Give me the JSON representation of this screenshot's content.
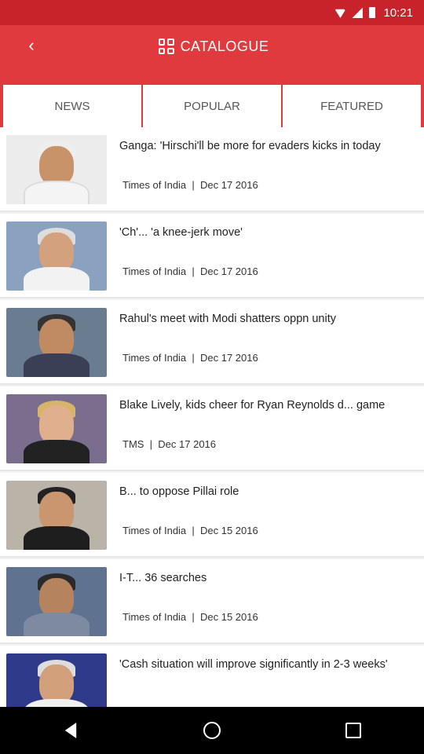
{
  "status_bar": {
    "time": "10:21"
  },
  "app_bar": {
    "back_icon": "chevron-left-icon",
    "catalogue_label": "CATALOGUE",
    "catalogue_icon": "grid-icon"
  },
  "tabs": [
    {
      "label": "NEWS"
    },
    {
      "label": "POPULAR"
    },
    {
      "label": "FEATURED"
    }
  ],
  "news": [
    {
      "headline": "Ganga: 'Hirschi'll be more for evaders kicks in today",
      "source": "Times of India",
      "date": "Dec 17 2016"
    },
    {
      "headline": "'Ch'... 'a knee-jerk move'",
      "source": "Times of India",
      "date": "Dec 17 2016"
    },
    {
      "headline": "Rahul's meet with Modi shatters oppn unity",
      "source": "Times of India",
      "date": "Dec 17 2016"
    },
    {
      "headline": "Blake Lively, kids cheer for Ryan Reynolds d... game",
      "source": "TMS",
      "date": "Dec 17 2016"
    },
    {
      "headline": "B... to oppose Pillai role",
      "source": "Times of India",
      "date": "Dec 15 2016"
    },
    {
      "headline": "I-T... 36 searches",
      "source": "Times of India",
      "date": "Dec 15 2016"
    },
    {
      "headline": "'Cash situation will improve significantly in 2-3 weeks'",
      "source": "",
      "date": ""
    }
  ],
  "nav_bar": {
    "back_icon": "triangle-back-icon",
    "home_icon": "circle-home-icon",
    "recents_icon": "square-recents-icon"
  },
  "colors": {
    "primary": "#e03a3e",
    "status_bar": "#c8232a"
  }
}
